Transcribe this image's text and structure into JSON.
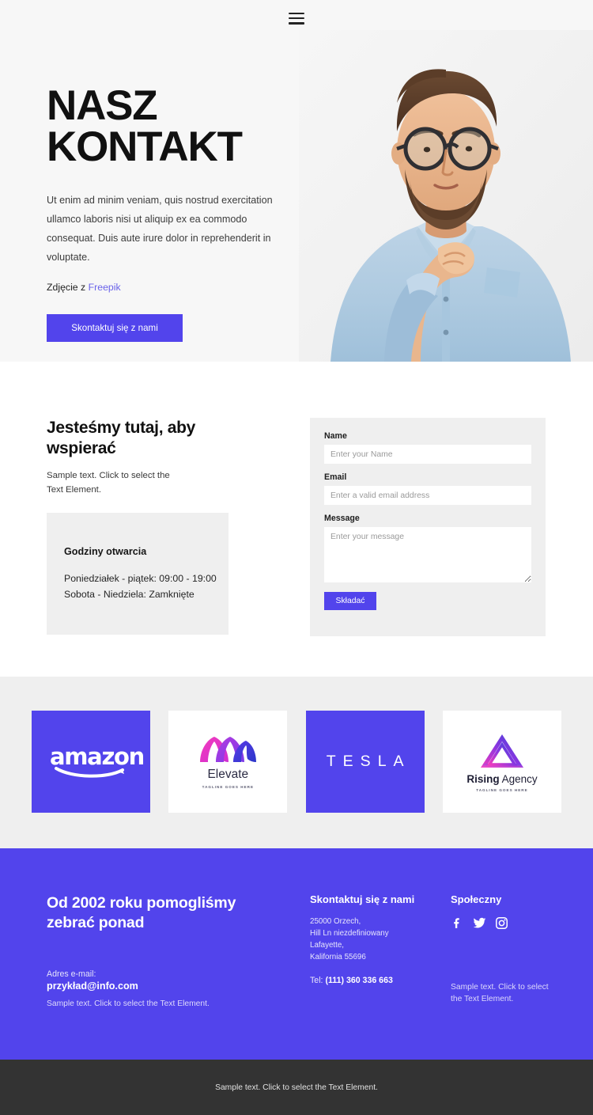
{
  "nav": {
    "menu_icon": "hamburger-menu-icon"
  },
  "hero": {
    "title_line1": "NASZ",
    "title_line2": "KONTAKT",
    "description": "Ut enim ad minim veniam, quis nostrud exercitation ullamco laboris nisi ut aliquip ex ea commodo consequat. Duis aute irure dolor in reprehenderit in voluptate.",
    "credit_prefix": "Zdjęcie z ",
    "credit_link": "Freepik",
    "cta_label": "Skontaktuj się z nami",
    "photo_alt": "bearded-man-with-glasses-thinking"
  },
  "contact": {
    "heading": "Jesteśmy tutaj, aby wspierać",
    "subtext": "Sample text. Click to select the Text Element.",
    "hours": {
      "title": "Godziny otwarcia",
      "lines": [
        "Poniedziałek - piątek: 09:00 - 19:00",
        "Sobota - Niedziela: Zamknięte"
      ]
    },
    "form": {
      "name_label": "Name",
      "name_placeholder": "Enter your Name",
      "email_label": "Email",
      "email_placeholder": "Enter a valid email address",
      "message_label": "Message",
      "message_placeholder": "Enter your message",
      "submit_label": "Składać"
    }
  },
  "logos": [
    {
      "name": "amazon",
      "wordmark": "amazon",
      "style": "purple"
    },
    {
      "name": "elevate",
      "wordmark": "Elevate",
      "tagline": "TAGLINE GOES HERE",
      "style": "white"
    },
    {
      "name": "tesla",
      "wordmark": "TESLA",
      "style": "purple"
    },
    {
      "name": "rising-agency",
      "wordmark_bold": "Rising",
      "wordmark_light": " Agency",
      "tagline": "TAGLINE GOES HERE",
      "style": "white"
    }
  ],
  "footer": {
    "headline": "Od 2002 roku pomogliśmy zebrać ponad",
    "email_label": "Adres e-mail:",
    "email_value": "przykład@info.com",
    "note_left": "Sample text. Click to select the Text Element.",
    "contact_heading": "Skontaktuj się z nami",
    "address_lines": [
      "25000 Orzech,",
      "Hill Ln niezdefiniowany",
      "Lafayette,",
      "Kalifornia 55696"
    ],
    "tel_label": "Tel: ",
    "tel_value": "(111) 360 336 663",
    "social_heading": "Społeczny",
    "socials": [
      "facebook-icon",
      "twitter-icon",
      "instagram-icon"
    ],
    "note_right": "Sample text. Click to select the Text Element."
  },
  "bottom": {
    "text": "Sample text. Click to select the Text Element."
  },
  "colors": {
    "accent": "#5244ec",
    "link": "#6a63ea",
    "hero_bg": "#f7f7f7",
    "panel_bg": "#efefef",
    "bottom_bar": "#333333"
  }
}
